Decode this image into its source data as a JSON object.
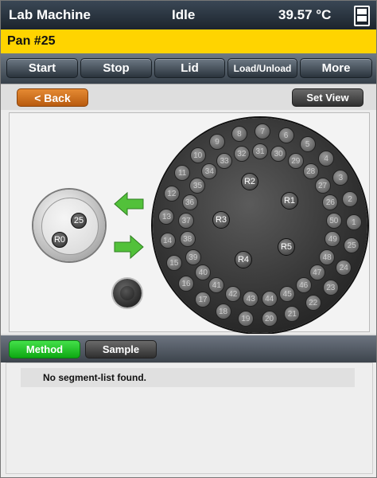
{
  "header": {
    "title": "Lab Machine",
    "status": "Idle",
    "temperature": "39.57 °C",
    "window_icon": "window-toggle-icon"
  },
  "pan": {
    "label": "Pan #25"
  },
  "toolbar": {
    "start": "Start",
    "stop": "Stop",
    "lid": "Lid",
    "load_unload": "Load/Unload",
    "more": "More"
  },
  "nav": {
    "back": "< Back",
    "set_view": "Set View"
  },
  "cell": {
    "positions": [
      "25",
      "R0"
    ]
  },
  "tray": {
    "positions": [
      "1",
      "2",
      "3",
      "4",
      "5",
      "6",
      "7",
      "8",
      "9",
      "10",
      "11",
      "12",
      "13",
      "14",
      "15",
      "16",
      "17",
      "18",
      "19",
      "20",
      "21",
      "22",
      "23",
      "24",
      "25",
      "26",
      "27",
      "28",
      "29",
      "30",
      "31",
      "32",
      "33",
      "34",
      "35",
      "36",
      "37",
      "38",
      "39",
      "40",
      "41",
      "42",
      "43",
      "44",
      "45",
      "46",
      "47",
      "48",
      "49",
      "50"
    ],
    "references": [
      "R1",
      "R2",
      "R3",
      "R4",
      "R5"
    ]
  },
  "icons": {
    "load_arrow": "arrow-left-icon",
    "unload_arrow": "arrow-right-icon"
  },
  "colors": {
    "status_bar": "#ffd400",
    "back_button": "#d27323",
    "active_tab": "#22c42a"
  },
  "tabs": {
    "method": "Method",
    "sample": "Sample"
  },
  "method": {
    "message": "No segment-list found."
  }
}
